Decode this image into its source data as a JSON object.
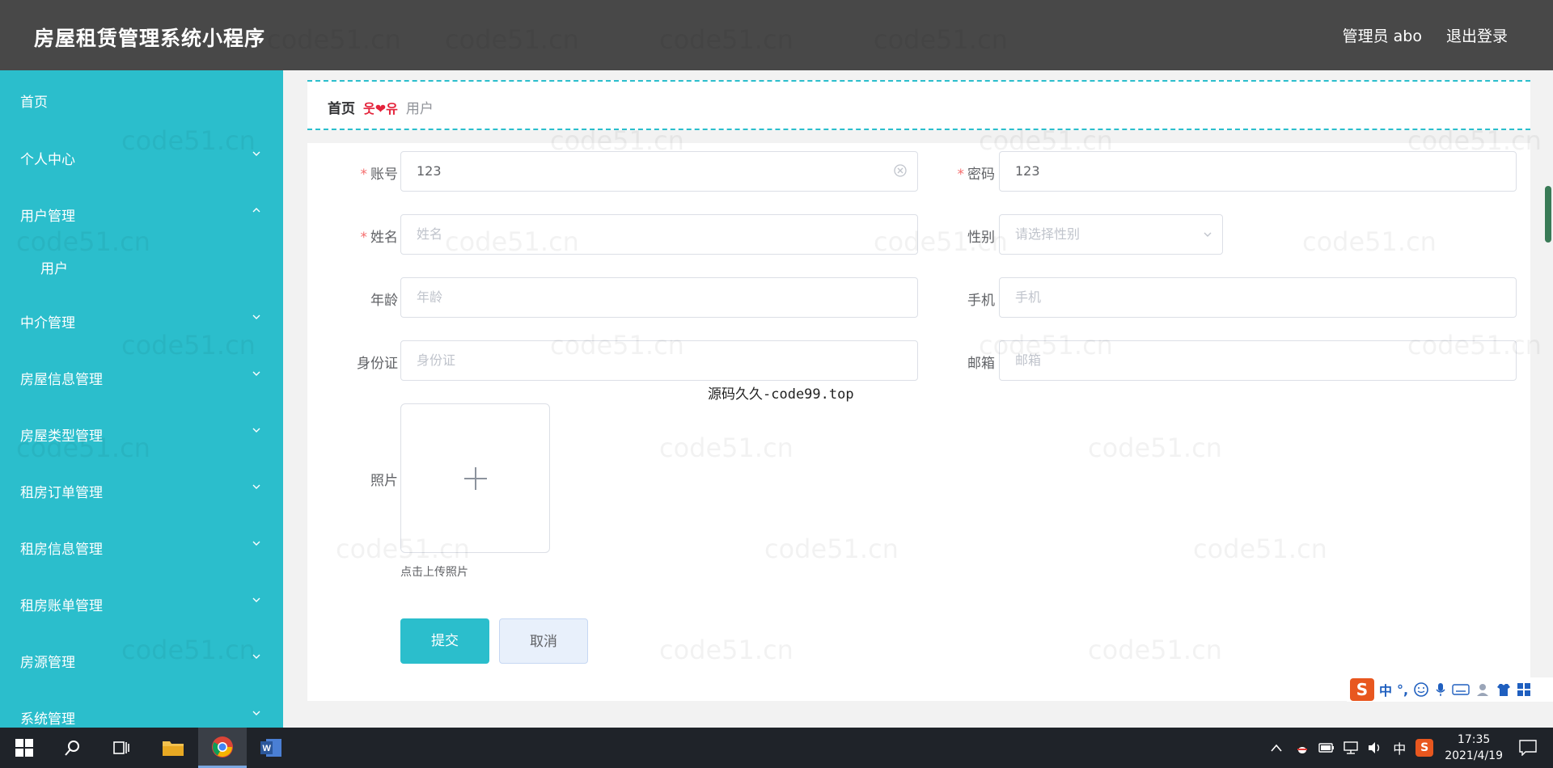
{
  "header": {
    "title": "房屋租赁管理系统小程序",
    "user_label": "管理员 abo",
    "logout_label": "退出登录"
  },
  "sidebar": {
    "items": [
      {
        "label": "首页"
      },
      {
        "label": "个人中心"
      },
      {
        "label": "用户管理"
      },
      {
        "label": "中介管理"
      },
      {
        "label": "房屋信息管理"
      },
      {
        "label": "房屋类型管理"
      },
      {
        "label": "租房订单管理"
      },
      {
        "label": "租房信息管理"
      },
      {
        "label": "租房账单管理"
      },
      {
        "label": "房源管理"
      },
      {
        "label": "系统管理"
      }
    ],
    "sub_user": "用户"
  },
  "breadcrumb": {
    "home": "首页",
    "separator": "웃❤유",
    "current": "用户"
  },
  "form": {
    "account": {
      "label": "账号",
      "value": "123"
    },
    "password": {
      "label": "密码",
      "value": "123"
    },
    "name": {
      "label": "姓名",
      "placeholder": "姓名"
    },
    "gender": {
      "label": "性别",
      "placeholder": "请选择性别"
    },
    "age": {
      "label": "年龄",
      "placeholder": "年龄"
    },
    "phone": {
      "label": "手机",
      "placeholder": "手机"
    },
    "idcard": {
      "label": "身份证",
      "placeholder": "身份证"
    },
    "email": {
      "label": "邮箱",
      "placeholder": "邮箱"
    },
    "photo": {
      "label": "照片",
      "tip": "点击上传照片"
    },
    "required_mark": "*",
    "submit_label": "提交",
    "cancel_label": "取消"
  },
  "overlay_text": "源码久久-code99.top",
  "watermark": "code51.cn",
  "ime": {
    "lang": "中",
    "punct": "°,"
  },
  "taskbar": {
    "time": "17:35",
    "date": "2021/4/19",
    "ime_lang": "中"
  },
  "colors": {
    "sidebar": "#2bbecc",
    "header": "#484848",
    "primary": "#2bbecc",
    "required": "#f56c6c"
  }
}
